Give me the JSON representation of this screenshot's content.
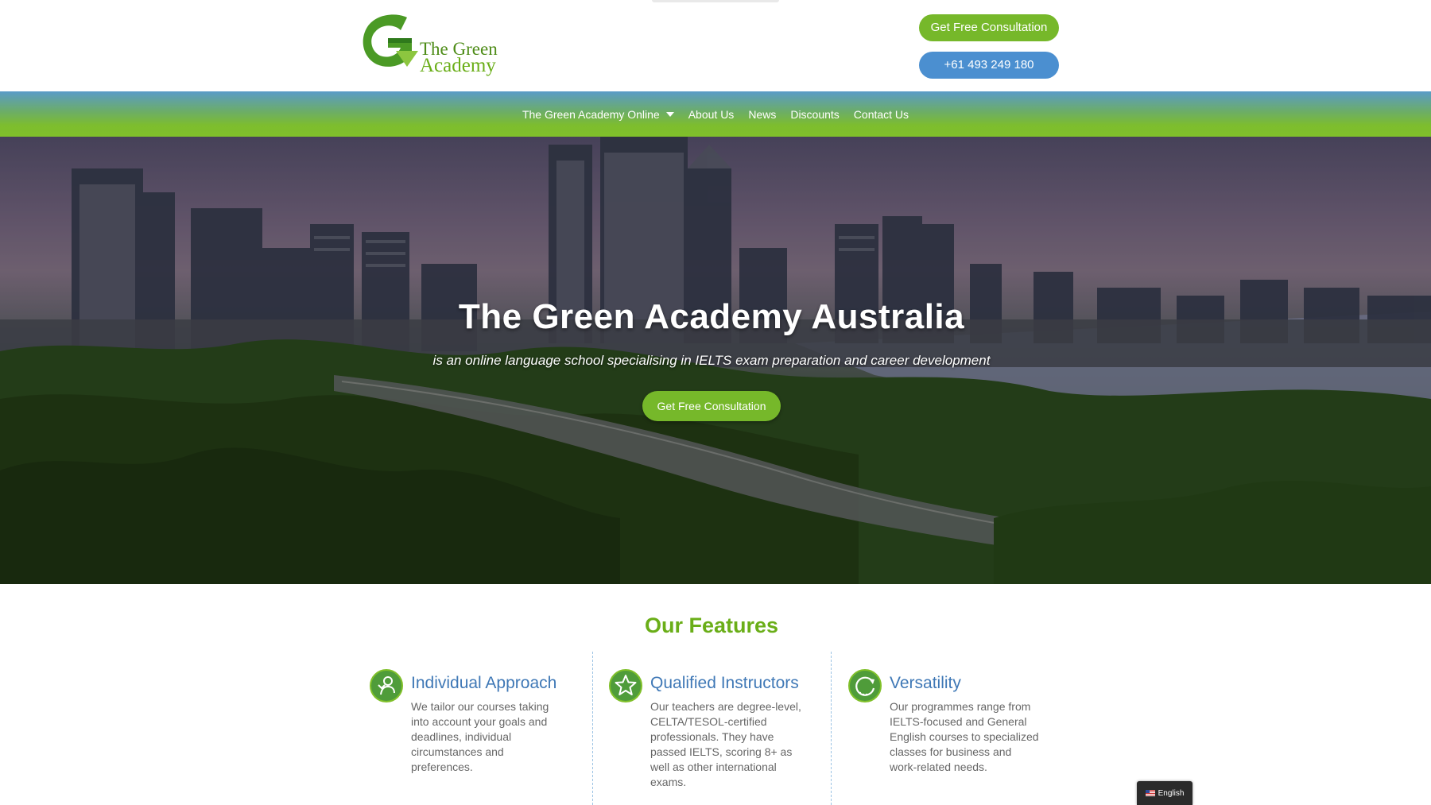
{
  "header": {
    "logo": {
      "line1": "The Green",
      "line2": "Academy"
    },
    "consult_button": "Get Free Consultation",
    "phone_button": "+61 493 249 180"
  },
  "nav": {
    "items": [
      {
        "label": "The Green Academy Online",
        "has_dropdown": true
      },
      {
        "label": "About Us"
      },
      {
        "label": "News"
      },
      {
        "label": "Discounts"
      },
      {
        "label": "Contact Us"
      }
    ]
  },
  "hero": {
    "title": "The Green Academy Australia",
    "subtitle": "is an online language school specialising in IELTS exam preparation and career development",
    "button": "Get Free Consultation"
  },
  "features": {
    "heading": "Our Features",
    "items": [
      {
        "icon": "person-icon",
        "title": "Individual Approach",
        "text": "We tailor our courses taking into account your goals and deadlines, individual circumstances and preferences."
      },
      {
        "icon": "star-icon",
        "title": "Qualified Instructors",
        "text": "Our teachers are degree-level, CELTA/TESOL-certified professionals. They have passed IELTS, scoring 8+ as well as other international exams."
      },
      {
        "icon": "refresh-icon",
        "title": "Versatility",
        "text": "Our programmes range from IELTS-focused and General English courses to specialized classes for business and work-related needs."
      }
    ]
  },
  "language_switcher": {
    "label": "English",
    "flag": "us-flag-icon"
  },
  "colors": {
    "brand_green": "#76b82a",
    "phone_blue": "#4b8fd0",
    "feature_title_blue": "#3f78b6",
    "heading_green": "#6aae18"
  }
}
